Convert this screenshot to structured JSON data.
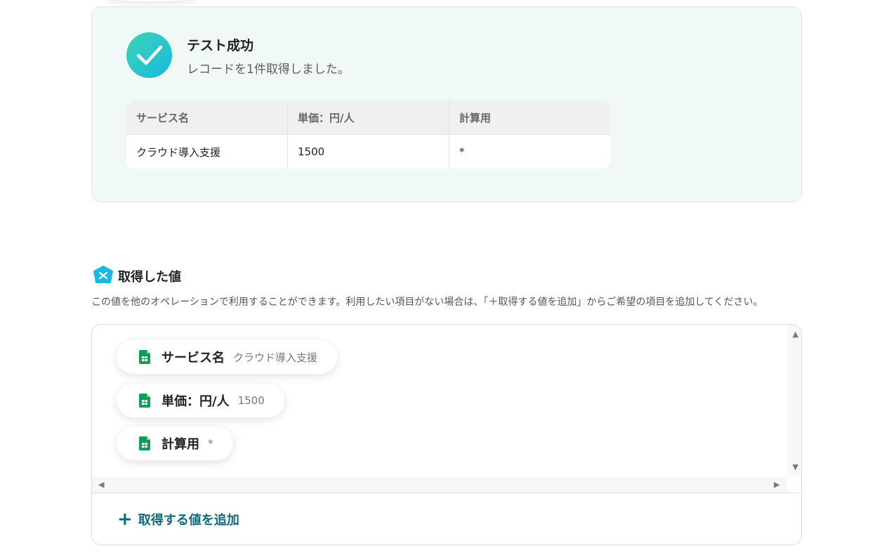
{
  "test_result": {
    "title": "テスト成功",
    "subtitle": "レコードを1件取得しました。",
    "table": {
      "headers": [
        "サービス名",
        "単価：円/人",
        "計算用"
      ],
      "rows": [
        [
          "クラウド導入支援",
          "1500",
          "*"
        ]
      ]
    }
  },
  "fetched_values": {
    "title": "取得した値",
    "description": "この値を他のオペレーションで利用することができます。利用したい項目がない場合は、「＋取得する値を追加」からご希望の項目を追加してください。",
    "items": [
      {
        "label": "サービス名",
        "value": "クラウド導入支援",
        "icon": "google-sheets-icon"
      },
      {
        "label": "単価：円/人",
        "value": "1500",
        "icon": "google-sheets-icon"
      },
      {
        "label": "計算用",
        "value": "*",
        "icon": "google-sheets-icon"
      }
    ],
    "add_button": {
      "plus": "+",
      "label": "取得する値を追加"
    }
  },
  "colors": {
    "success_gradient_start": "#3ad6b6",
    "success_gradient_end": "#1bb8e0",
    "accent": "#0e6a7e",
    "sheets_green": "#0f9d58",
    "card_bg": "#f1f9f8"
  }
}
